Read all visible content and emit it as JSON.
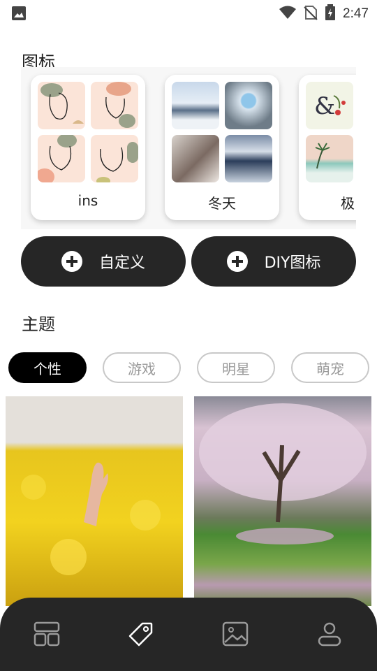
{
  "status_bar": {
    "time": "2:47",
    "icons": [
      "image-icon",
      "wifi-icon",
      "no-sim-icon",
      "battery-charging-icon"
    ]
  },
  "icons_section": {
    "title": "图标",
    "cards": [
      {
        "label": "ins"
      },
      {
        "label": "冬天"
      },
      {
        "label": "极"
      }
    ],
    "buttons": {
      "custom_label": "自定义",
      "diy_label": "DIY图标"
    }
  },
  "theme_section": {
    "title": "主题",
    "chips": [
      "个性",
      "游戏",
      "明星",
      "萌宠"
    ],
    "selected_chip": "个性"
  },
  "bottom_nav": {
    "items": [
      "layout-icon",
      "tag-icon",
      "image-gallery-icon",
      "profile-icon"
    ],
    "selected": "tag-icon"
  }
}
